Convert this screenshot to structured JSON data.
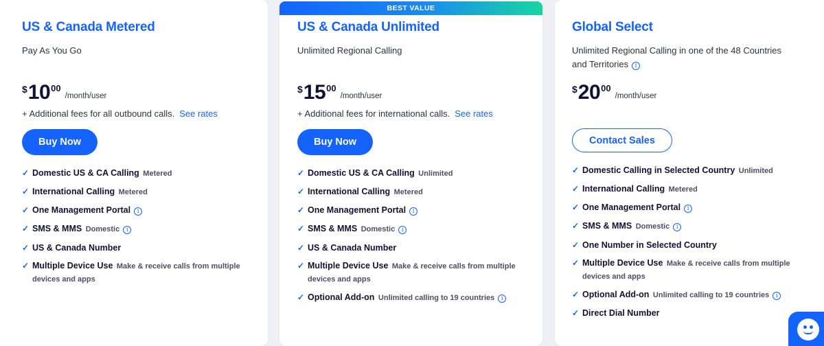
{
  "colors": {
    "accent": "#1463ff",
    "text": "#0f1330",
    "muted": "#4a4f63",
    "background": "#eef0f4"
  },
  "plans": [
    {
      "title": "US & Canada Metered",
      "subtitle": "Pay As You Go",
      "price": {
        "currency": "$",
        "amount": "10",
        "cents": "00",
        "period": "/month/user"
      },
      "fees": "+ Additional fees for all outbound calls.",
      "rates_link": "See rates",
      "cta": "Buy Now",
      "features": [
        {
          "name": "Domestic US & CA Calling",
          "note": "Metered"
        },
        {
          "name": "International Calling",
          "note": "Metered"
        },
        {
          "name": "One Management Portal",
          "note": ""
        },
        {
          "name": "SMS & MMS",
          "note": "Domestic"
        },
        {
          "name": "US & Canada Number",
          "note": ""
        },
        {
          "name": "Multiple Device Use",
          "note": "Make & receive calls from multiple devices and apps"
        }
      ]
    },
    {
      "badge": "BEST VALUE",
      "title": "US & Canada Unlimited",
      "subtitle": "Unlimited Regional Calling",
      "price": {
        "currency": "$",
        "amount": "15",
        "cents": "00",
        "period": "/month/user"
      },
      "fees": "+ Additional fees for international calls.",
      "rates_link": "See rates",
      "cta": "Buy Now",
      "features": [
        {
          "name": "Domestic US & CA Calling",
          "note": "Unlimited"
        },
        {
          "name": "International Calling",
          "note": "Metered"
        },
        {
          "name": "One Management Portal",
          "note": ""
        },
        {
          "name": "SMS & MMS",
          "note": "Domestic"
        },
        {
          "name": "US & Canada Number",
          "note": ""
        },
        {
          "name": "Multiple Device Use",
          "note": "Make & receive calls from multiple devices and apps"
        },
        {
          "name": "Optional Add-on",
          "note": "Unlimited calling to 19 countries"
        }
      ]
    },
    {
      "title": "Global Select",
      "subtitle": "Unlimited Regional Calling in one of the 48 Countries and Territories",
      "price": {
        "currency": "$",
        "amount": "20",
        "cents": "00",
        "period": "/month/user"
      },
      "cta": "Contact Sales",
      "features": [
        {
          "name": "Domestic Calling in Selected Country",
          "note": "Unlimited"
        },
        {
          "name": "International Calling",
          "note": "Metered"
        },
        {
          "name": "One Management Portal",
          "note": ""
        },
        {
          "name": "SMS & MMS",
          "note": "Domestic"
        },
        {
          "name": "One Number in Selected Country",
          "note": ""
        },
        {
          "name": "Multiple Device Use",
          "note": "Make & receive calls from multiple devices and apps"
        },
        {
          "name": "Optional Add-on",
          "note": "Unlimited calling to 19 countries"
        },
        {
          "name": "Direct Dial Number",
          "note": ""
        }
      ]
    }
  ],
  "icons": {
    "info": "info-icon",
    "check": "check-icon",
    "chat": "chat-bot-icon"
  }
}
